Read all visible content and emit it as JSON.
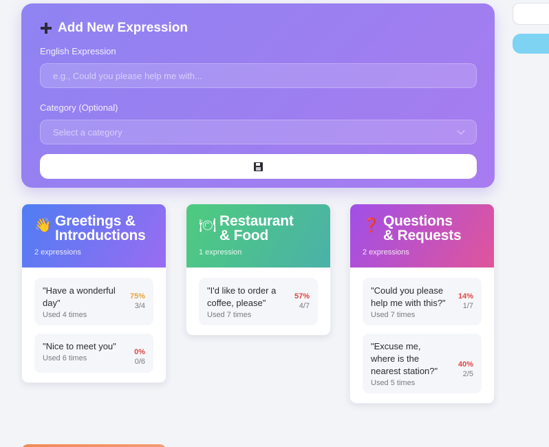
{
  "add_form": {
    "title": "Add New Expression",
    "english_label": "English Expression",
    "english_placeholder": "e.g., Could you please help me with...",
    "english_value": "",
    "category_label": "Category (Optional)",
    "category_placeholder": "Select a category",
    "save_icon": "floppy-disk-icon"
  },
  "categories": [
    {
      "title_line1": "Greetings &",
      "title_line2": "Introductions",
      "emoji": "👋",
      "count": "2 expressions",
      "gradient": [
        "#4f7df3",
        "#9a6cf2"
      ],
      "expressions": [
        {
          "text": "\"Have a wonderful day\"",
          "rate": "75%",
          "rate_color": "#e8a23a",
          "fraction": "3/4",
          "used": "Used 4 times"
        },
        {
          "text": "\"Nice to meet you\"",
          "rate": "0%",
          "rate_color": "#e04545",
          "fraction": "0/6",
          "used": "Used 6 times"
        }
      ]
    },
    {
      "title_line1": "Restaurant",
      "title_line2": "& Food",
      "emoji": "🍽",
      "count": "1 expression",
      "gradient": [
        "#4ecb7e",
        "#4bb1a8"
      ],
      "expressions": [
        {
          "text": "\"I'd like to order a coffee, please\"",
          "rate": "57%",
          "rate_color": "#e04545",
          "fraction": "4/7",
          "used": "Used 7 times"
        }
      ]
    },
    {
      "title_line1": "Questions",
      "title_line2": "& Requests",
      "emoji": "❓",
      "count": "2 expressions",
      "gradient": [
        "#a04fe8",
        "#e0559a"
      ],
      "expressions": [
        {
          "text": "\"Could you please help me with this?\"",
          "rate": "14%",
          "rate_color": "#e04545",
          "fraction": "1/7",
          "used": "Used 7 times"
        },
        {
          "text": "\"Excuse me, where is the nearest station?\"",
          "rate": "40%",
          "rate_color": "#e04545",
          "fraction": "2/5",
          "used": "Used 5 times"
        }
      ]
    }
  ]
}
